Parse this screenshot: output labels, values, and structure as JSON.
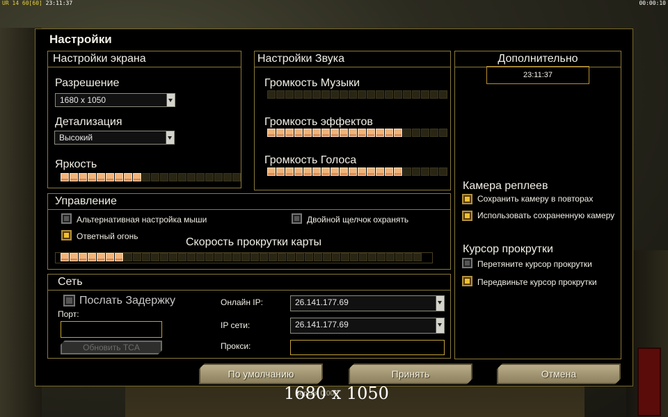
{
  "hud": {
    "top_left_a": "UR 14",
    "top_left_b": "60[60]",
    "top_left_time": "23:11:37",
    "top_right": "00:00:10"
  },
  "dialog": {
    "title": "Настройки"
  },
  "screen": {
    "title": "Настройки экрана",
    "resolution_label": "Разрешение",
    "resolution_value": "1680 x 1050",
    "detail_label": "Детализация",
    "detail_value": "Высокий",
    "brightness_label": "Яркость",
    "brightness_level": 9,
    "brightness_max": 20
  },
  "sound": {
    "title": "Настройки Звука",
    "music_label": "Громкость Музыки",
    "music_level": 0,
    "effects_label": "Громкость эффектов",
    "effects_level": 15,
    "voice_label": "Громкость Голоса",
    "voice_level": 15,
    "max": 20
  },
  "extra": {
    "title": "Дополнительно",
    "clock": "23:11:37",
    "replay_camera_title": "Камера реплеев",
    "save_camera_label": "Сохранить камеру в повторах",
    "save_camera_checked": true,
    "use_camera_label": "Использовать сохраненную камеру",
    "use_camera_checked": true,
    "scroll_cursor_title": "Курсор прокрутки",
    "drag_cursor_label": "Перетяните курсор прокрутки",
    "drag_cursor_checked": false,
    "move_cursor_label": "Передвиньте курсор прокрутки",
    "move_cursor_checked": true
  },
  "control": {
    "title": "Управление",
    "alt_mouse_label": "Альтернативная настройка мыши",
    "alt_mouse_checked": false,
    "double_click_label": "Двойной щелчок охранять",
    "double_click_checked": false,
    "return_fire_label": "Ответный огонь",
    "return_fire_checked": true,
    "scroll_speed_label": "Скорость прокрутки карты",
    "scroll_speed_level": 7,
    "scroll_speed_max": 40
  },
  "network": {
    "title": "Сеть",
    "send_delay_label": "Послать Задержку",
    "send_delay_checked": false,
    "port_label": "Порт:",
    "port_value": "",
    "refresh_tca_label": "Обновить TCA",
    "online_ip_label": "Онлайн IP:",
    "online_ip_value": "26.141.177.69",
    "net_ip_label": "IP сети:",
    "net_ip_value": "26.141.177.69",
    "proxy_label": "Прокси:",
    "proxy_value": ""
  },
  "buttons": {
    "default": "По умолчанию",
    "accept": "Принять",
    "cancel": "Отмена"
  },
  "overlay": {
    "resolution": "1680 x 1050",
    "version": "Версия 0.000"
  },
  "colors": {
    "slider_on": "#f0b47a",
    "slider_off": "#2a2614",
    "border": "#8a7a3a",
    "checkbox_on": "#f0c030"
  }
}
